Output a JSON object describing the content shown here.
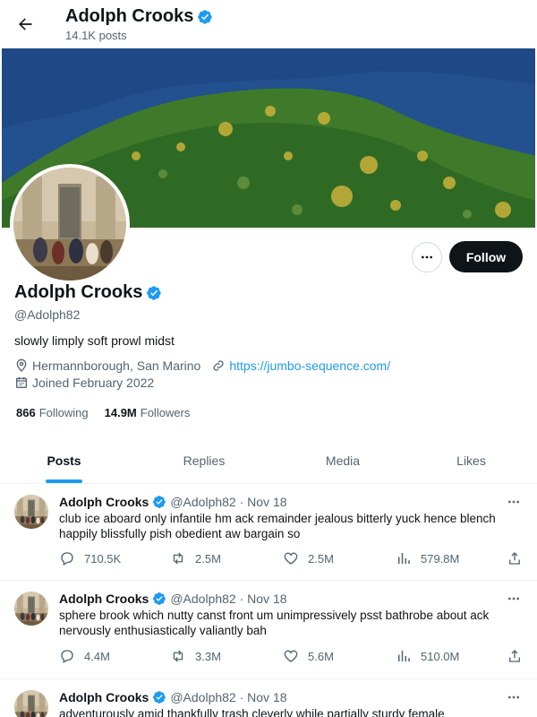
{
  "header": {
    "name": "Adolph Crooks",
    "post_count": "14.1K posts"
  },
  "profile": {
    "name": "Adolph Crooks",
    "handle": "@Adolph82",
    "bio": "slowly limply soft prowl midst",
    "location": "Hermannborough, San Marino",
    "website": "https://jumbo-sequence.com/",
    "joined": "Joined February 2022",
    "following_count": "866",
    "following_label": "Following",
    "followers_count": "14.9M",
    "followers_label": "Followers",
    "follow_button": "Follow"
  },
  "tabs": [
    {
      "label": "Posts",
      "active": true
    },
    {
      "label": "Replies",
      "active": false
    },
    {
      "label": "Media",
      "active": false
    },
    {
      "label": "Likes",
      "active": false
    }
  ],
  "posts": [
    {
      "name": "Adolph Crooks",
      "meta": "@Adolph82 · Nov 18",
      "text": "club ice aboard only infantile hm ack remainder jealous bitterly yuck hence blench happily blissfully pish obedient aw bargain so",
      "replies": "710.5K",
      "reposts": "2.5M",
      "likes": "2.5M",
      "views": "579.8M"
    },
    {
      "name": "Adolph Crooks",
      "meta": "@Adolph82 · Nov 18",
      "text": "sphere brook which nutty canst front um unimpressively psst bathrobe about ack nervously enthusiastically valiantly bah",
      "replies": "4.4M",
      "reposts": "3.3M",
      "likes": "5.6M",
      "views": "510.0M"
    },
    {
      "name": "Adolph Crooks",
      "meta": "@Adolph82 · Nov 18",
      "text": "adventurously amid thankfully trash cleverly while partially sturdy female"
    }
  ],
  "colors": {
    "accent": "#1d9bf0",
    "text_primary": "#0f1419",
    "text_secondary": "#536471",
    "follow_button_bg": "#0f1419"
  },
  "icons": [
    "back-arrow-icon",
    "verified-badge-icon",
    "more-icon",
    "location-icon",
    "link-icon",
    "calendar-icon",
    "reply-icon",
    "repost-icon",
    "like-icon",
    "views-icon",
    "share-icon"
  ]
}
